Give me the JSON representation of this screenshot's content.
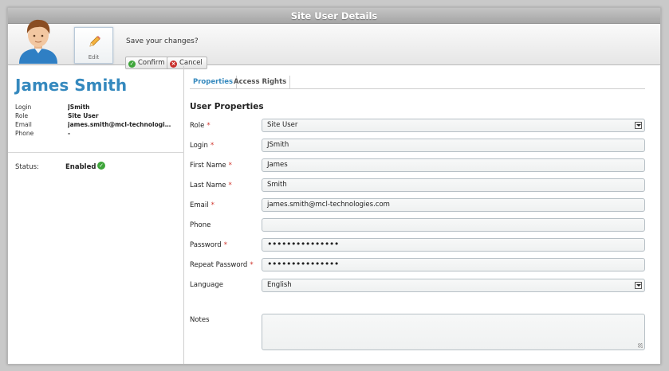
{
  "window": {
    "title": "Site User Details"
  },
  "toolbar": {
    "edit_label": "Edit",
    "save_question": "Save your changes?",
    "confirm_label": "Confirm",
    "cancel_label": "Cancel"
  },
  "user": {
    "name": "James Smith",
    "info": [
      {
        "key": "Login",
        "value": "JSmith"
      },
      {
        "key": "Role",
        "value": "Site User"
      },
      {
        "key": "Email",
        "value": "james.smith@mcl-technologi..."
      },
      {
        "key": "Phone",
        "value": "-"
      }
    ],
    "status_label": "Status:",
    "status_value": "Enabled"
  },
  "tabs": [
    {
      "label": "Properties",
      "active": true
    },
    {
      "label": "Access Rights",
      "active": false
    }
  ],
  "form": {
    "section_title": "User Properties",
    "role": {
      "label": "Role",
      "value": "Site User"
    },
    "login": {
      "label": "Login",
      "value": "JSmith"
    },
    "first_name": {
      "label": "First Name",
      "value": "James"
    },
    "last_name": {
      "label": "Last Name",
      "value": "Smith"
    },
    "email": {
      "label": "Email",
      "value": "james.smith@mcl-technologies.com"
    },
    "phone": {
      "label": "Phone",
      "value": ""
    },
    "password": {
      "label": "Password",
      "value": "•••••••••••••••"
    },
    "repeat_password": {
      "label": "Repeat Password",
      "value": "•••••••••••••••"
    },
    "language": {
      "label": "Language",
      "value": "English"
    },
    "notes": {
      "label": "Notes",
      "value": ""
    },
    "required_marker": "*"
  },
  "colors": {
    "accent": "#3589be",
    "required": "#d0342c",
    "status_ok": "#3ea53a",
    "cancel": "#c9302c"
  },
  "icons": {
    "avatar": "user-avatar",
    "edit": "pencil-icon",
    "confirm": "check-circle-icon",
    "cancel": "x-circle-icon",
    "status": "check-circle-icon",
    "dropdown": "chevron-down-icon"
  }
}
